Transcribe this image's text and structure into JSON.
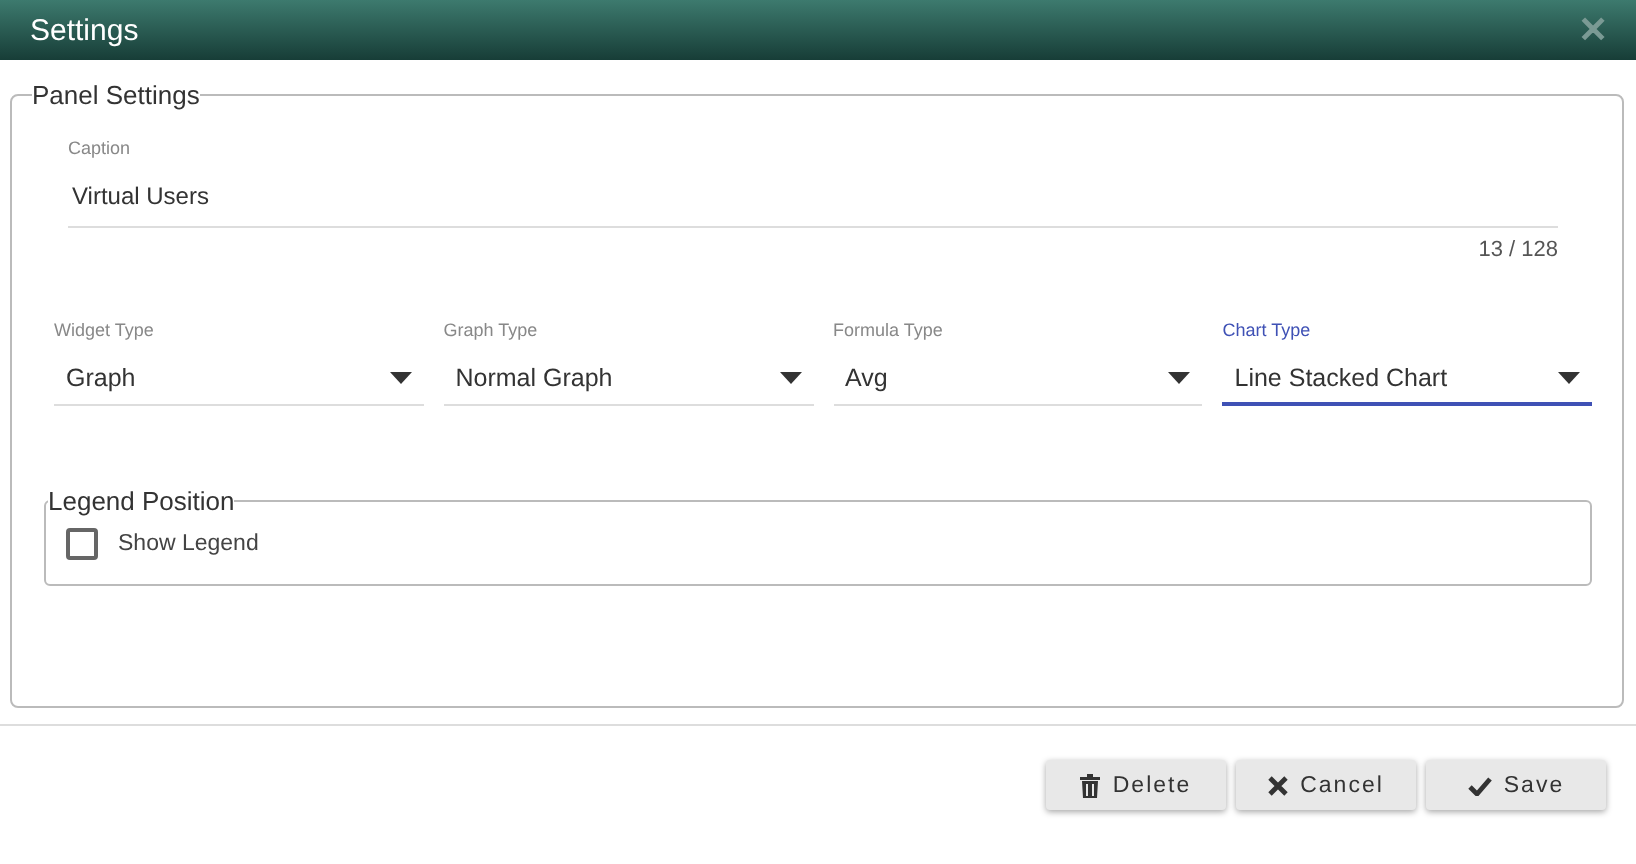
{
  "window": {
    "title": "Settings",
    "close": "✕"
  },
  "panel": {
    "legend": "Panel Settings",
    "caption": {
      "label": "Caption",
      "value": "Virtual Users",
      "counter": "13 / 128"
    },
    "dropdowns": [
      {
        "label": "Widget Type",
        "value": "Graph",
        "focused": false
      },
      {
        "label": "Graph Type",
        "value": "Normal Graph",
        "focused": false
      },
      {
        "label": "Formula Type",
        "value": "Avg",
        "focused": false
      },
      {
        "label": "Chart Type",
        "value": "Line Stacked Chart",
        "focused": true
      }
    ],
    "legend_position": {
      "legend": "Legend Position",
      "checkbox": {
        "label": "Show Legend",
        "checked": false
      }
    }
  },
  "buttons": [
    {
      "label": "Delete",
      "kind": "delete"
    },
    {
      "label": "Cancel",
      "kind": "cancel"
    },
    {
      "label": "Save",
      "kind": "save"
    }
  ]
}
